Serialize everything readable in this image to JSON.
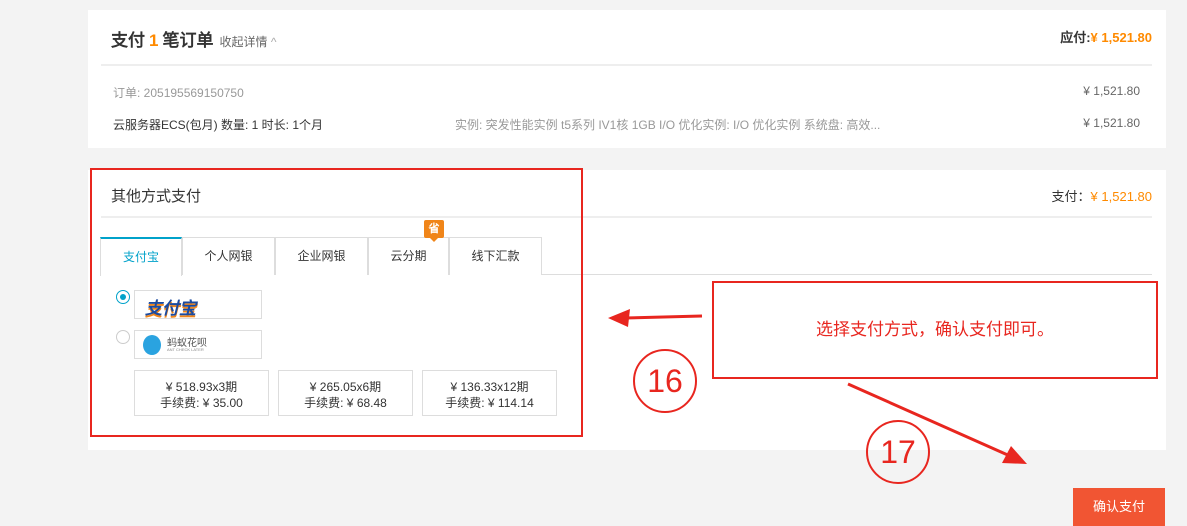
{
  "summary": {
    "title_pre": "支付",
    "count": "1",
    "title_post": "笔订单",
    "collapse": "收起详情",
    "due_label": "应付:",
    "due_amount": "¥ 1,521.80"
  },
  "order": {
    "id_label": "订单: 205195569150750",
    "id_amount": "¥ 1,521.80",
    "item": "云服务器ECS(包月) 数量: 1 时长: 1个月",
    "spec": "实例: 突发性能实例 t5系列 IV1核 1GB I/O 优化实例: I/O 优化实例 系统盘: 高效...",
    "item_amount": "¥ 1,521.80"
  },
  "pay": {
    "title": "其他方式支付",
    "due_label": "支付：",
    "due_amount": "¥ 1,521.80",
    "badge": "省",
    "tabs": [
      {
        "label": "支付宝"
      },
      {
        "label": "个人网银"
      },
      {
        "label": "企业网银"
      },
      {
        "label": "云分期"
      },
      {
        "label": "线下汇款"
      }
    ],
    "methods": [
      {
        "name": "支付宝"
      },
      {
        "name": "蚂蚁花呗",
        "sub": "ANT CHECK LATER"
      }
    ],
    "installments": [
      {
        "price": "¥ 518.93x3期",
        "fee": "手续费: ¥ 35.00"
      },
      {
        "price": "¥ 265.05x6期",
        "fee": "手续费: ¥ 68.48"
      },
      {
        "price": "¥ 136.33x12期",
        "fee": "手续费: ¥ 114.14"
      }
    ]
  },
  "confirm": "确认支付",
  "annotation": {
    "note": "选择支付方式，确认支付即可。",
    "step1": "16",
    "step2": "17"
  }
}
